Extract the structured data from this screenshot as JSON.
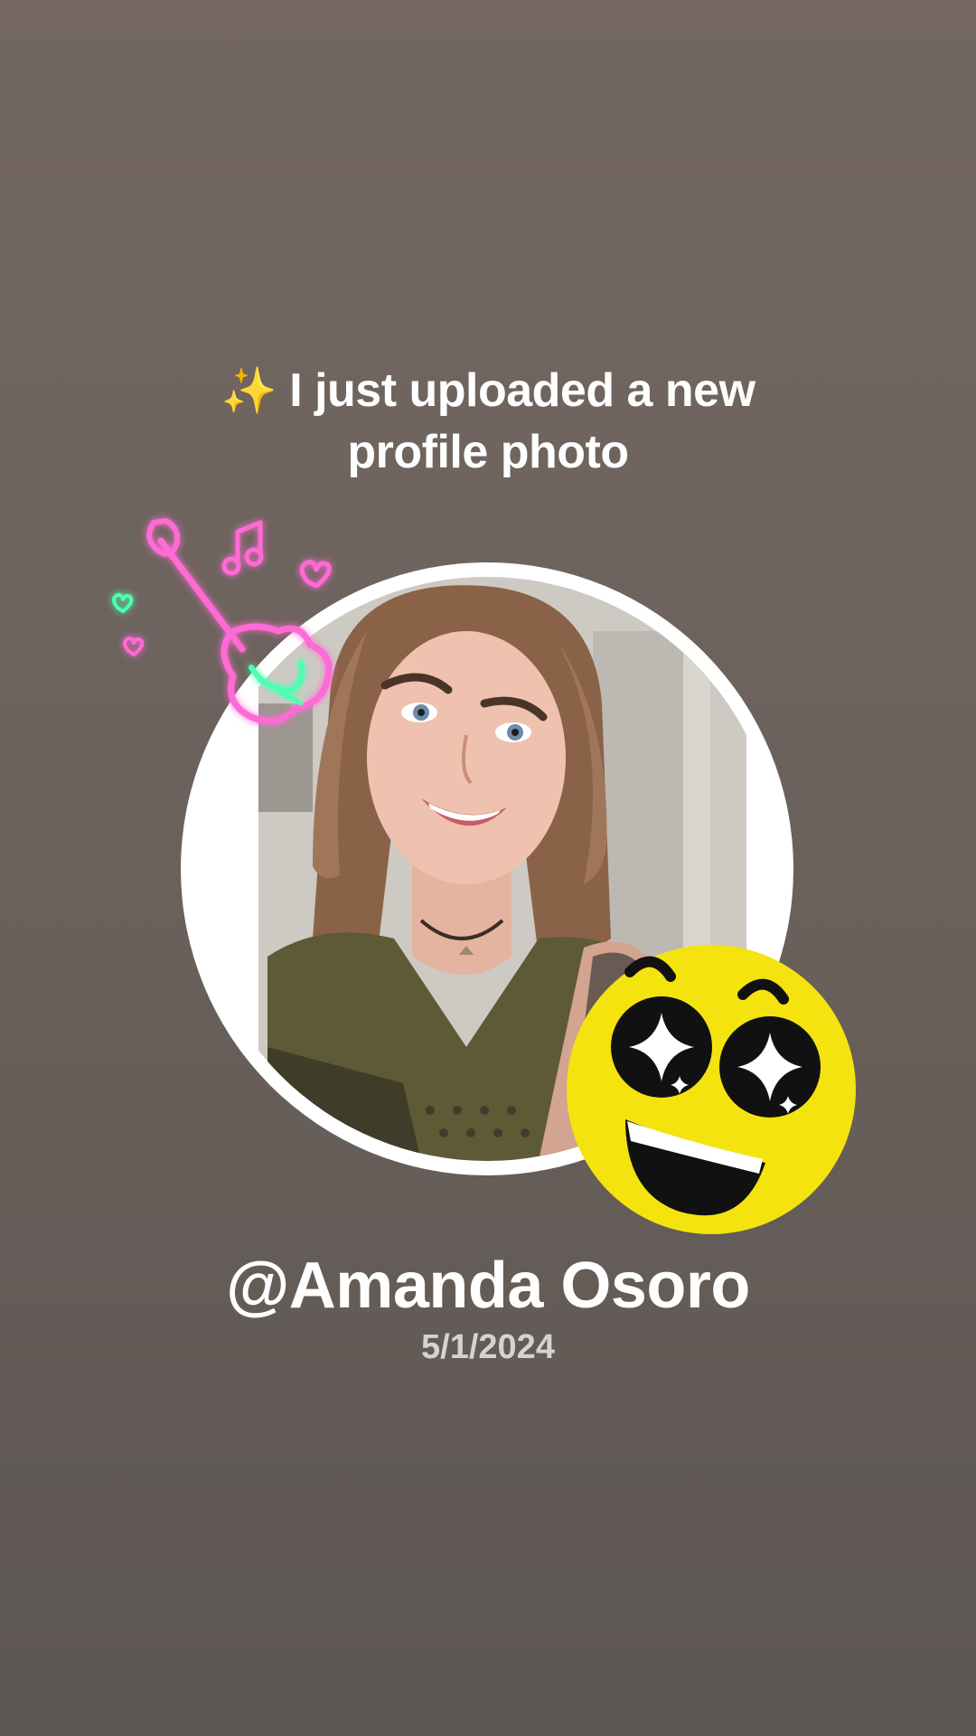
{
  "headline": {
    "sparkle_icon": "sparkles-emoji",
    "line1": "I just uploaded a new",
    "line2": "profile photo"
  },
  "profile": {
    "username": "@Amanda Osoro",
    "date": "5/1/2024"
  },
  "stickers": {
    "guitar": "neon-guitar-sticker",
    "emoji": "starry-eyed-smiley-sticker"
  },
  "colors": {
    "background_top": "#736760",
    "background_bottom": "#5c5652",
    "text": "#ffffff",
    "date_text": "#d8d2ce",
    "emoji_yellow": "#f5e30f",
    "neon_pink": "#ff6ad5",
    "neon_green": "#4dffb0"
  }
}
